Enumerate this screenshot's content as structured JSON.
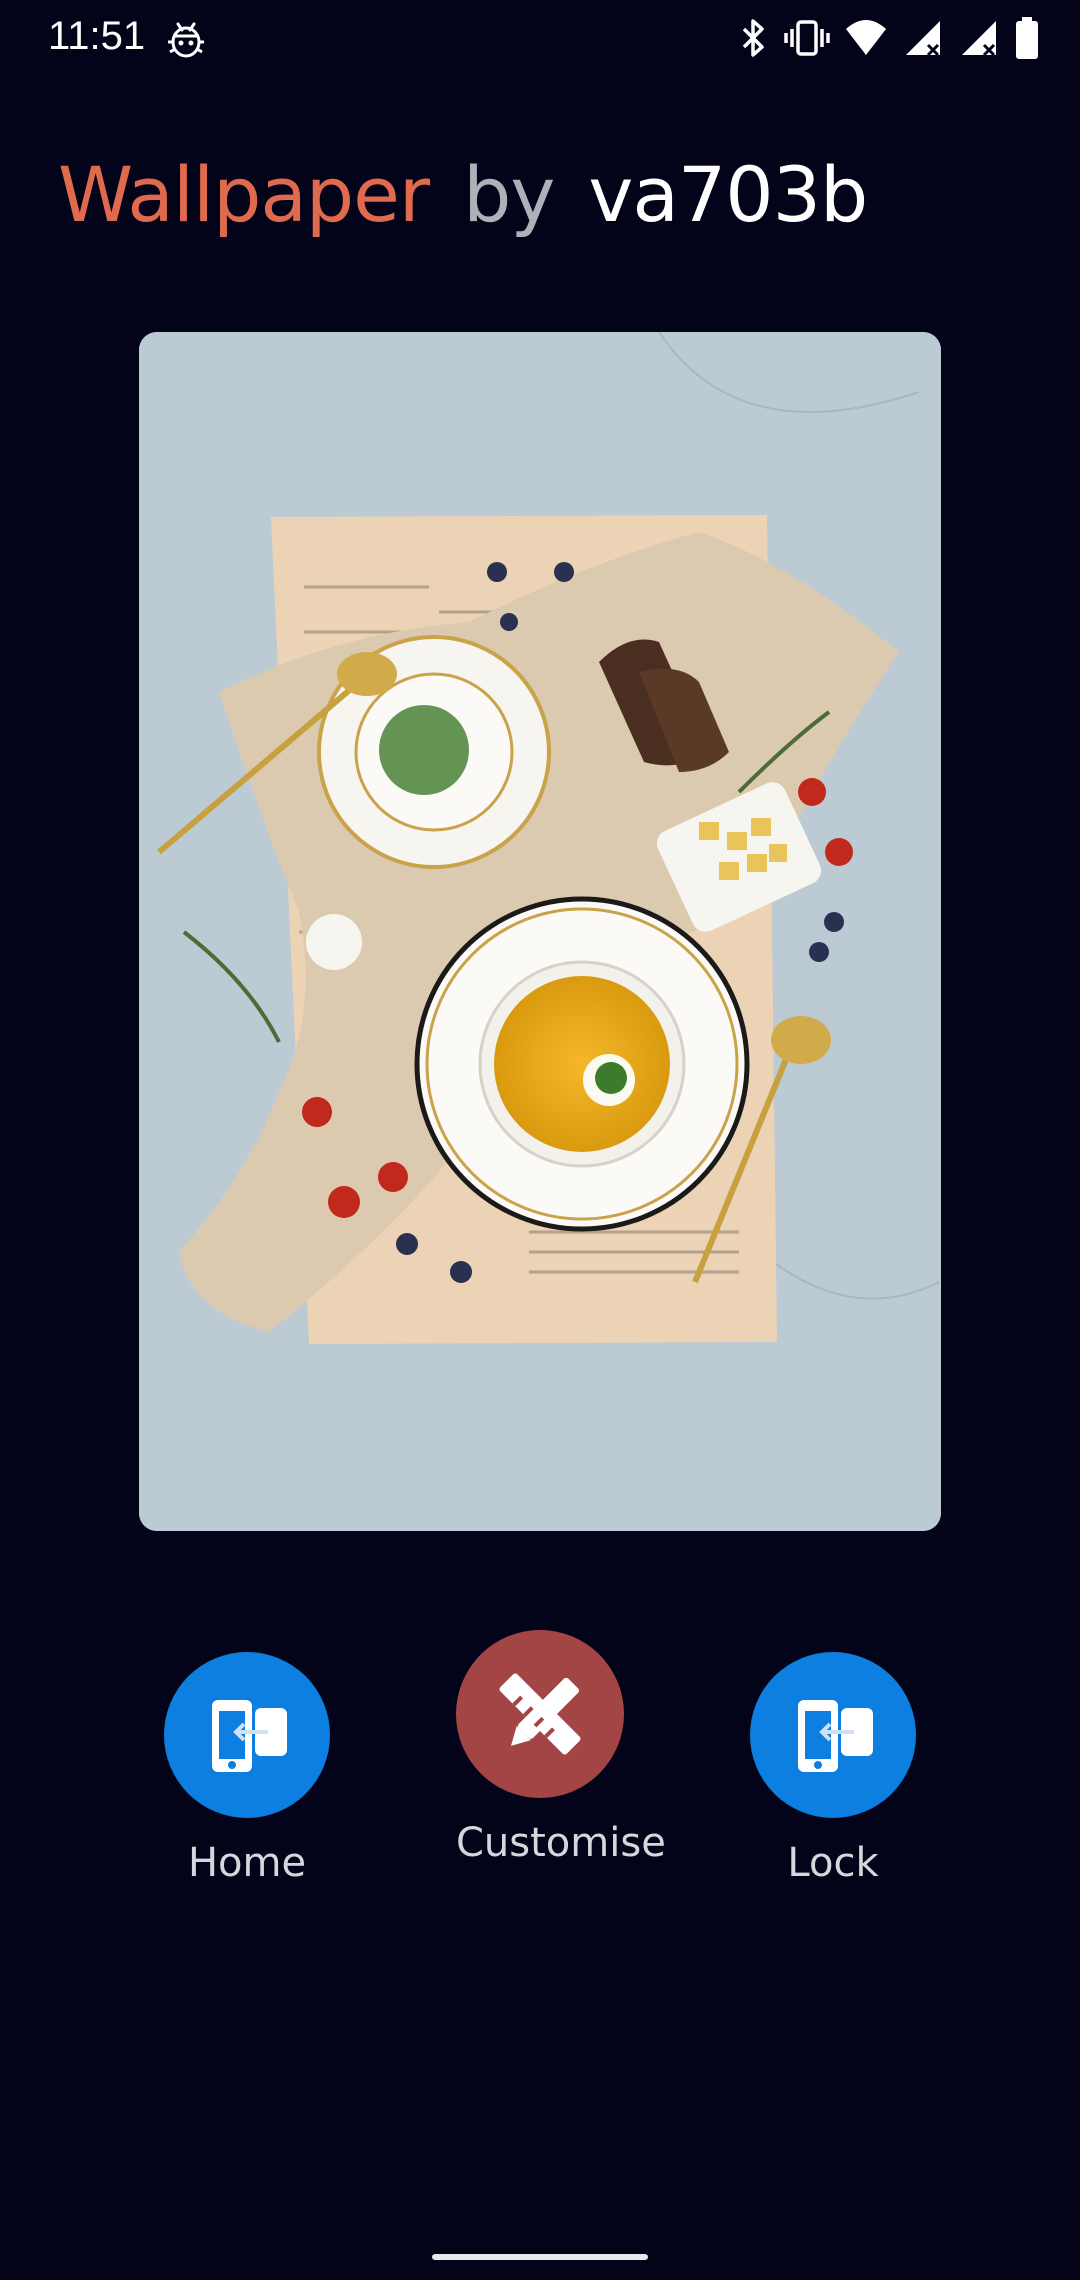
{
  "status_bar": {
    "time": "11:51",
    "left_icon": "bug-icon",
    "right_icons": [
      "bluetooth-icon",
      "vibrate-icon",
      "wifi-icon",
      "signal-icon",
      "signal-icon",
      "battery-icon"
    ]
  },
  "header": {
    "title": "Wallpaper",
    "by": "by",
    "author": "va703b"
  },
  "preview": {
    "image": "food-flatlay-wallpaper"
  },
  "actions": {
    "home_label": "Home",
    "customise_label": "Customise",
    "lock_label": "Lock"
  },
  "colors": {
    "background": "#03041a",
    "title_accent": "#e06a4e",
    "home_lock_button": "#0c7fe0",
    "customise_button": "#a44545"
  }
}
